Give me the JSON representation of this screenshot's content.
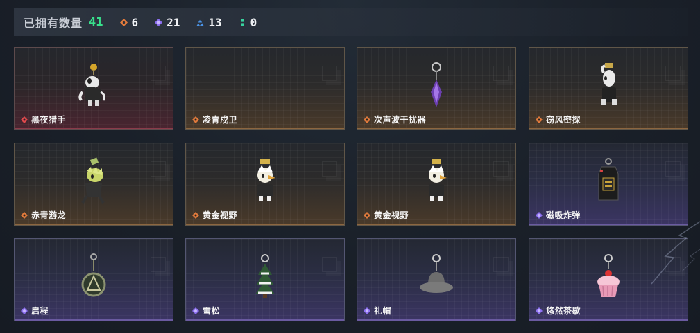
{
  "summary": {
    "label": "已拥有数量",
    "total": "41",
    "stats": [
      {
        "icon": "orange-diamond-icon",
        "color": "#e07a3c",
        "value": "6"
      },
      {
        "icon": "purple-diamond-icon",
        "color": "#8c6ff0",
        "value": "21"
      },
      {
        "icon": "blue-triangle-icon",
        "color": "#4a93e6",
        "value": "13"
      },
      {
        "icon": "green-colon-icon",
        "color": "#38d39f",
        "value": "0"
      }
    ]
  },
  "items": [
    {
      "name": "黑夜猎手",
      "rarity": "red",
      "icon": "white-cat-figure-charm-icon"
    },
    {
      "name": "凌青戍卫",
      "rarity": "orange",
      "icon": "empty-charm-icon"
    },
    {
      "name": "次声波干扰器",
      "rarity": "orange",
      "icon": "purple-crystal-charm-icon"
    },
    {
      "name": "窃风密探",
      "rarity": "orange",
      "icon": "white-rabbit-figure-charm-icon"
    },
    {
      "name": "赤青游龙",
      "rarity": "orange",
      "icon": "green-dragon-figure-charm-icon"
    },
    {
      "name": "黄金视野",
      "rarity": "orange",
      "icon": "gold-figure-charm-icon"
    },
    {
      "name": "黄金视野",
      "rarity": "orange",
      "icon": "gold-figure-charm-icon"
    },
    {
      "name": "磁吸炸弹",
      "rarity": "purple",
      "icon": "bomb-device-charm-icon"
    },
    {
      "name": "启程",
      "rarity": "purple",
      "icon": "medallion-charm-icon"
    },
    {
      "name": "雪松",
      "rarity": "purple",
      "icon": "snow-pine-tree-charm-icon"
    },
    {
      "name": "礼帽",
      "rarity": "purple",
      "icon": "fedora-hat-charm-icon"
    },
    {
      "name": "悠然茶歇",
      "rarity": "purple",
      "icon": "cupcake-charm-icon"
    }
  ]
}
